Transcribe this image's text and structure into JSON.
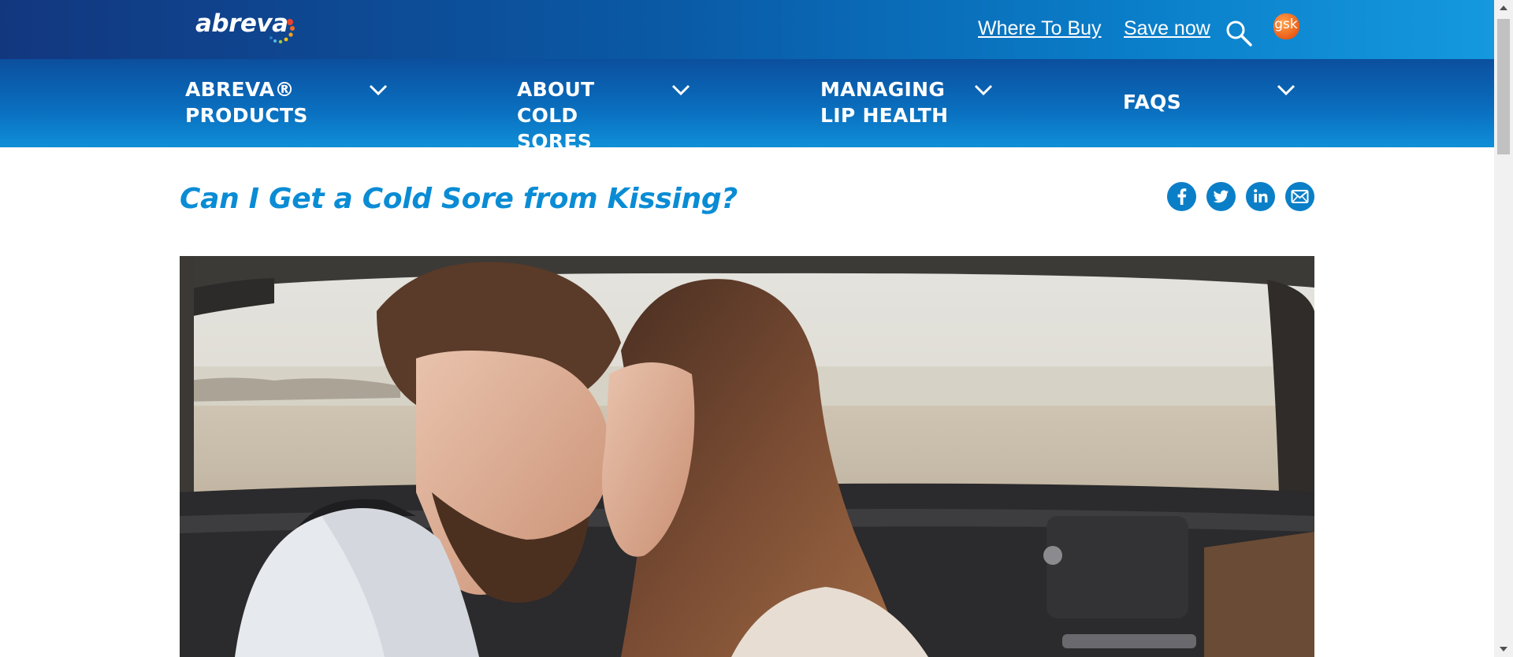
{
  "brand": {
    "logo_text": "abreva",
    "parent_logo_text": "gsk"
  },
  "header": {
    "where_to_buy": "Where To Buy",
    "save_now": "Save now"
  },
  "nav": {
    "items": [
      {
        "label": "ABREVA® PRODUCTS"
      },
      {
        "label": "ABOUT COLD SORES"
      },
      {
        "label": "MANAGING LIP HEALTH"
      },
      {
        "label": "FAQS"
      }
    ]
  },
  "article": {
    "title": "Can I Get a Cold Sore from Kissing?"
  },
  "share_icons": [
    "facebook-icon",
    "twitter-icon",
    "linkedin-icon",
    "email-icon"
  ],
  "colors": {
    "brand_blue": "#0a8cd5",
    "nav_dark": "#0b4f9e",
    "gsk_orange": "#f36b21"
  }
}
